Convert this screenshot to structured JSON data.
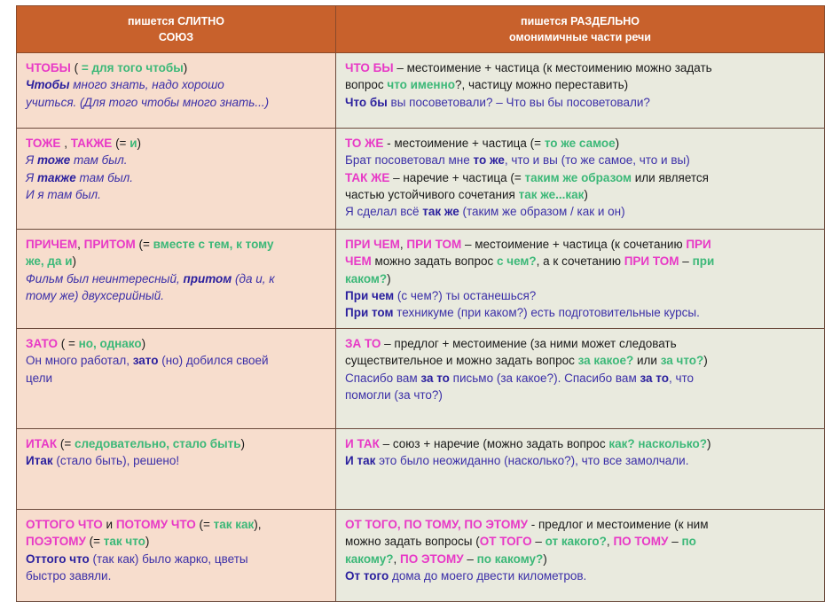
{
  "document": {
    "title": "Слитное и раздельное написание союзов и омонимичных частей речи",
    "colors": {
      "header_bg": "#c8612c",
      "header_text": "#ffffff",
      "left_cell_bg": "#f7ddcd",
      "right_cell_bg": "#e9eade",
      "border": "#6b4a3c",
      "magenta": "#e838c6",
      "green": "#3cb878",
      "blue": "#3b2fa8",
      "bold_blue": "#2a1f9e",
      "black": "#1a1a1a"
    }
  },
  "header": {
    "left_line1": "пишется СЛИТНО",
    "left_line2": "СОЮЗ",
    "right_line1": "пишется РАЗДЕЛЬНО",
    "right_line2": "омонимичные части речи"
  },
  "rows": [
    {
      "left": {
        "l1a": "ЧТОБЫ",
        "l1b": " ( ",
        "l1c": "= для того чтобы",
        "l1d": ")",
        "l2a": "Чтобы",
        "l2b": " много знать, надо хорошо",
        "l3a": "учиться. (Для того чтобы много знать...)"
      },
      "right": {
        "l1a": "ЧТО БЫ",
        "l1b": " – местоимение + частица (к местоимению можно задать",
        "l2a": "вопрос ",
        "l2b": "что именно",
        "l2c": "?, частицу можно переставить)",
        "l3a": "Что бы",
        "l3b": " вы посоветовали? – Что вы бы посоветовали?"
      }
    },
    {
      "left": {
        "l1a": "ТОЖЕ",
        "l1b": " , ",
        "l1c": "ТАКЖЕ",
        "l1d": " (= ",
        "l1e": "и",
        "l1f": ")",
        "l2a": "Я ",
        "l2b": "тоже",
        "l2c": " там был.",
        "l3a": "Я ",
        "l3b": "также",
        "l3c": " там был.",
        "l4a": "И я там был."
      },
      "right": {
        "l1a": "ТО ЖЕ",
        "l1b": " -  местоимение + частица (= ",
        "l1c": "то же самое",
        "l1d": ")",
        "l2a": "Брат посоветовал мне ",
        "l2b": "то же",
        "l2c": ", что и вы (то же самое, что и вы)",
        "l3a": "ТАК ЖЕ",
        "l3b": " – наречие + частица (= ",
        "l3c": "таким же образом",
        "l3d": " или является",
        "l4a": "частью устойчивого сочетания ",
        "l4b": "так же...как",
        "l4c": ")",
        "l5a": "Я сделал всё ",
        "l5b": "так же",
        "l5c": " (таким же образом / как и он)"
      }
    },
    {
      "left": {
        "l1a": "ПРИЧЕМ",
        "l1b": ", ",
        "l1c": "ПРИТОМ",
        "l1d": " (= ",
        "l1e": "вместе с тем, к тому",
        "l2a": "же, да и",
        "l2b": ")",
        "l3a": "Фильм был неинтересный, ",
        "l3b": "притом",
        "l3c": " (да и, к",
        "l4a": "тому же) двухсерийный."
      },
      "right": {
        "l1a": "ПРИ ЧЕМ",
        "l1b": ", ",
        "l1c": "ПРИ ТОМ",
        "l1d": " – местоимение + частица (к сочетанию ",
        "l1e": "ПРИ",
        "l2a": "ЧЕМ",
        "l2b": " можно задать вопрос ",
        "l2c": "с чем?",
        "l2d": ", а к сочетанию ",
        "l2e": "ПРИ ТОМ",
        "l2f": " – ",
        "l2g": "при",
        "l3a": "каком?",
        "l3b": ")",
        "l4a": "При чем",
        "l4b": " (с чем?) ты останешься?",
        "l5a": "При том",
        "l5b": " техникуме (при каком?) есть подготовительные курсы."
      }
    },
    {
      "left": {
        "l1a": "ЗАТО",
        "l1b": " ( = ",
        "l1c": "но, однако",
        "l1d": ")",
        "l2a": "Он много работал, ",
        "l2b": "зато",
        "l2c": " (но) добился своей",
        "l3a": "цели"
      },
      "right": {
        "l1a": "ЗА ТО",
        "l1b": " – предлог + местоимение (за ними может следовать",
        "l2a": "существительное и можно задать вопрос ",
        "l2b": "за какое?",
        "l2c": " или ",
        "l2d": "за что?",
        "l2e": ")",
        "l3a": "Спасибо вам ",
        "l3b": "за то",
        "l3c": " письмо (за какое?). Спасибо вам ",
        "l3d": "за то",
        "l3e": ", что",
        "l4a": "помогли (за что?)"
      }
    },
    {
      "left": {
        "l1a": "ИТАК",
        "l1b": " (= ",
        "l1c": "следовательно, стало быть",
        "l1d": ")",
        "l2a": "Итак",
        "l2b": " (стало быть), решено!"
      },
      "right": {
        "l1a": "И ТАК",
        "l1b": " – союз + наречие (можно задать вопрос ",
        "l1c": "как? насколько?",
        "l1d": ")",
        "l2a": "И так",
        "l2b": " это было неожиданно (насколько?), что все замолчали."
      }
    },
    {
      "left": {
        "l1a": "ОТТОГО ЧТО",
        "l1b": " и ",
        "l1c": "ПОТОМУ ЧТО",
        "l1d": " (= ",
        "l1e": "так как",
        "l1f": "),",
        "l2a": "ПОЭТОМУ",
        "l2b": " (= ",
        "l2c": "так что",
        "l2d": ")",
        "l3a": "Оттого что",
        "l3b": " (так как) было жарко, цветы",
        "l4a": "быстро завяли."
      },
      "right": {
        "l1a": "ОТ ТОГО, ПО ТОМУ, ПО ЭТОМУ",
        "l1b": " -  предлог и местоимение (к ним",
        "l2a": "можно задать вопросы (",
        "l2b": "ОТ ТОГО",
        "l2c": " – ",
        "l2d": "от какого?",
        "l2e": ", ",
        "l2f": "ПО ТОМУ",
        "l2g": " – ",
        "l2h": "по",
        "l3a": "какому?",
        "l3b": ", ",
        "l3c": "ПО ЭТОМУ",
        "l3d": " – ",
        "l3e": "по какому?",
        "l3f": ")",
        "l4a": "От того",
        "l4b": " дома до моего двести километров."
      }
    }
  ]
}
